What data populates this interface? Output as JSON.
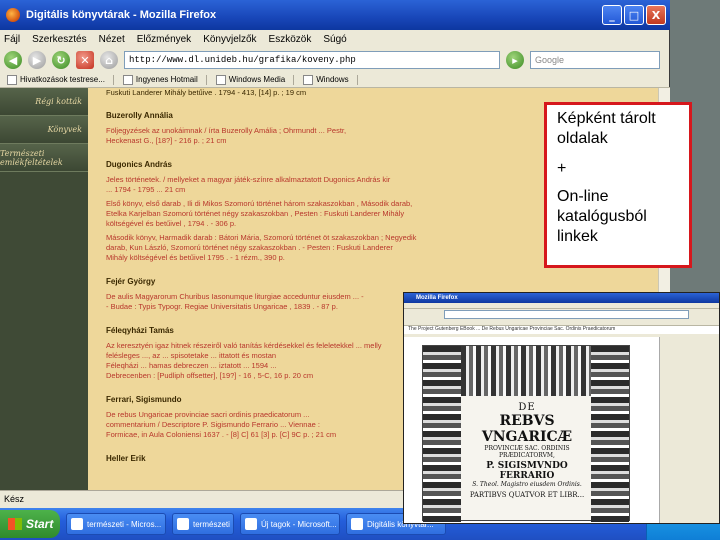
{
  "window": {
    "title": "Digitális könyvtárak - Mozilla Firefox",
    "buttons": {
      "minimize": "_",
      "maximize": "□",
      "close": "X"
    }
  },
  "menu": [
    "Fájl",
    "Szerkesztés",
    "Nézet",
    "Előzmények",
    "Könyvjelzők",
    "Eszközök",
    "Súgó"
  ],
  "nav": {
    "url": "http://www.dl.unideb.hu/grafika/koveny.php",
    "search_placeholder": "Google"
  },
  "bookmarks": [
    "Hivatkozások testrese...",
    "Ingyenes Hotmail",
    "Windows Media",
    "Windows"
  ],
  "sidebar": {
    "items": [
      "Régi kották",
      "Könyvek",
      "Természeti emlékfeltételek"
    ]
  },
  "content": {
    "top_line": "Fuskuti Landerer Mihály betűive . 1794 - 413, [14] p. ; 19 cm",
    "sections": [
      {
        "author": "Buzerolly Annália",
        "entries": [
          [
            "Följegyzések az unokáimnak / írta Buzerolly Amália ; Ohrmundt ... Pestr,",
            "Heckenast G., [18?] - 216 p. ; 21 cm"
          ]
        ]
      },
      {
        "author": "Dugonics András",
        "entries": [
          [
            "Jeles történetek. / mellyeket a magyar játék-színre alkalmaztatott Dugonics András kir",
            "... 1794 - 1795 ... 21 cm"
          ],
          [
            "Első könyv, első darab , Ili di Mikos Szomorú történet három szakaszokban , Második darab,",
            "Etelka Karjelban Szomorú történet négy szakaszokban , Pesten : Fuskuti Landerer Mihály",
            "költségével és betűivel , 1794 . - 306 p."
          ],
          [
            "Második könyv, Harmadik darab : Bátori Mária, Szomorú történet öt szakaszokban ; Negyedik",
            "darab, Kun László, Szomorú történet négy szakaszokban . - Pesten : Fuskuti Landerer",
            "Mihály költségével és betűivel 1795 . - 1 rézm., 390 p."
          ]
        ]
      },
      {
        "author": "Fejér György",
        "entries": [
          [
            "De aulis Magyarorum Churibus Iasonumque liturgiae acceduntur eiusdem ... -",
            "- Budae : Typis Typogr. Regiae Universitatis Ungaricae , 1839 . - 87 p."
          ]
        ]
      },
      {
        "author": "Féleqyházi Tamás",
        "entries": [
          [
            "Az keresztyén igaz hitnek részeiről való tanítás kérdésekkel és feleletekkel ... melly",
            "felésleges ..., az ... spisotetake ... ittatott és mostan",
            "Féleqházi ... hamas debreczen ... iztatott ... 1594 ...",
            "Debrecenben : [Pudliph offsetter], [19?] - 16 , 5-C, 16 p. 20 cm"
          ]
        ]
      },
      {
        "author": "Ferrari, Sigismundo",
        "entries": [
          [
            "De rebus Ungaricae provinciae sacri ordinis praedicatorum ...",
            "commentarium / Descriptore P. Sigismundo Ferrario ... Viennae :",
            "Formicae, in Aula Coloniensi 1637 . - [8] C] 61 [3] p. [C] 9C p. ; 21 cm"
          ]
        ]
      },
      {
        "author": "Heller Erik",
        "entries": []
      }
    ]
  },
  "status": "Kész",
  "taskbar": {
    "start": "Start",
    "tasks": [
      "természeti - Micros...",
      "természeti",
      "Új tagok - Microsoft...",
      "Digitális könyvtár..."
    ]
  },
  "callout": {
    "line1": "Képként tárolt oldalak",
    "plus": "+",
    "line2": "On-line katalógusból linkek"
  },
  "viewer": {
    "title": "Mozilla Firefox",
    "caption": "The Project Gutenberg EBook ... De Rebus Ungaricae Provinciae Sac. Ordinis Praedicatorum",
    "page": {
      "line1": "DE",
      "line2": "REBVS VNGARICÆ",
      "line3": "PROVINCIÆ SAC. ORDINIS PRÆDICATORVM,",
      "line4": "P. SIGISMVNDO FERRARIO",
      "line5": "S. Theol. Magistro eiusdem Ordinis.",
      "line6": "PARTIBVS QUATVOR ET LIBR..."
    }
  }
}
